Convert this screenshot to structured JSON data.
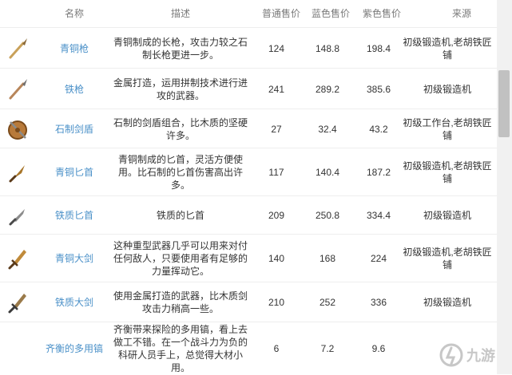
{
  "table": {
    "headers": {
      "name": "名称",
      "desc": "描述",
      "p1": "普通售价",
      "p2": "蓝色售价",
      "p3": "紫色售价",
      "source": "来源"
    },
    "rows": [
      {
        "icon": "bronze-spear-icon",
        "name": "青铜枪",
        "desc": "青铜制成的长枪，攻击力较之石制长枪更进一步。",
        "p1": "124",
        "p2": "148.8",
        "p3": "198.4",
        "source": "初级锻造机,老胡铁匠铺"
      },
      {
        "icon": "iron-spear-icon",
        "name": "铁枪",
        "desc": "金属打造，运用拼制技术进行进攻的武器。",
        "p1": "241",
        "p2": "289.2",
        "p3": "385.6",
        "source": "初级锻造机"
      },
      {
        "icon": "stone-shield-icon",
        "name": "石制剑盾",
        "desc": "石制的剑盾组合，比木质的坚硬许多。",
        "p1": "27",
        "p2": "32.4",
        "p3": "43.2",
        "source": "初级工作台,老胡铁匠铺"
      },
      {
        "icon": "bronze-dagger-icon",
        "name": "青铜匕首",
        "desc": "青铜制成的匕首，灵活方便使用。比石制的匕首伤害高出许多。",
        "p1": "117",
        "p2": "140.4",
        "p3": "187.2",
        "source": "初级锻造机,老胡铁匠铺"
      },
      {
        "icon": "iron-dagger-icon",
        "name": "铁质匕首",
        "desc": "铁质的匕首",
        "p1": "209",
        "p2": "250.8",
        "p3": "334.4",
        "source": "初级锻造机"
      },
      {
        "icon": "bronze-greatsword-icon",
        "name": "青铜大剑",
        "desc": "这种重型武器几乎可以用来对付任何敌人，只要使用者有足够的力量挥动它。",
        "p1": "140",
        "p2": "168",
        "p3": "224",
        "source": "初级锻造机,老胡铁匠铺"
      },
      {
        "icon": "iron-greatsword-icon",
        "name": "铁质大剑",
        "desc": "使用金属打造的武器，比木质剑攻击力稍高一些。",
        "p1": "210",
        "p2": "252",
        "p3": "336",
        "source": "初级锻造机"
      },
      {
        "icon": "",
        "name": "齐衡的多用镐",
        "desc": "齐衡带来探险的多用镐，看上去做工不错。在一个战斗力为负的科研人员手上，总觉得大材小用。",
        "p1": "6",
        "p2": "7.2",
        "p3": "9.6",
        "source": ""
      }
    ]
  },
  "watermark": {
    "logo": "jiuyou-logo-icon",
    "text": "九游"
  },
  "colors": {
    "name_link": "#4a90c8",
    "border": "#eeeeee",
    "header_text": "#7a7a7a"
  }
}
